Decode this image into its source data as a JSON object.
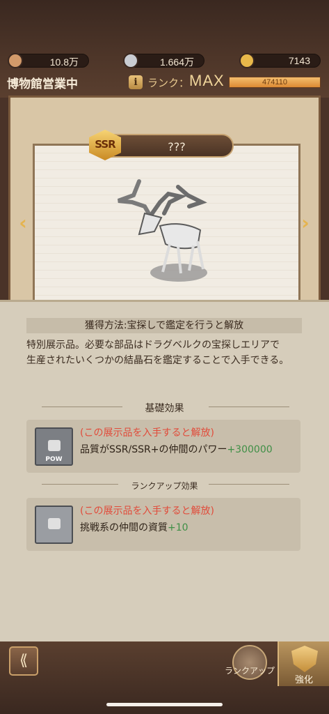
{
  "header": {
    "currencies": [
      {
        "icon": "bronze-coin-icon",
        "value": "10.8万",
        "color": "#d39a6a"
      },
      {
        "icon": "silver-coin-icon",
        "value": "1.664万",
        "color": "#c9ccd2"
      },
      {
        "icon": "gold-coin-icon",
        "value": "7143",
        "color": "#e8b84a"
      }
    ],
    "museum_status": "博物館営業中",
    "rank_label": "ランク：",
    "rank_value": "MAX",
    "rank_progress_text": "474110",
    "rank_progress": 1.0
  },
  "exhibit": {
    "rarity": "SSR",
    "name": "???"
  },
  "info": {
    "acquisition": "獲得方法:宝探しで鑑定を行うと解放",
    "description_line1": "特別展示品。必要な部品はドラグベルクの宝探しエリアで",
    "description_line2": "生産されたいくつかの結晶石を鑑定することで入手できる。",
    "basic_effect_title": "基礎効果",
    "basic_effect": {
      "condition": "(この展示品を入手すると解放)",
      "text": "品質がSSR/SSR+の仲間のパワー",
      "bonus": "+300000",
      "icon_label": "POW"
    },
    "rankup_effect_title": "ランクアップ効果",
    "rankup_effect": {
      "condition": "(この展示品を入手すると解放)",
      "text": "挑戦系の仲間の資質",
      "bonus": "+10"
    }
  },
  "footer": {
    "rankup_label": "ランクアップ",
    "enhance_label": "強化"
  }
}
